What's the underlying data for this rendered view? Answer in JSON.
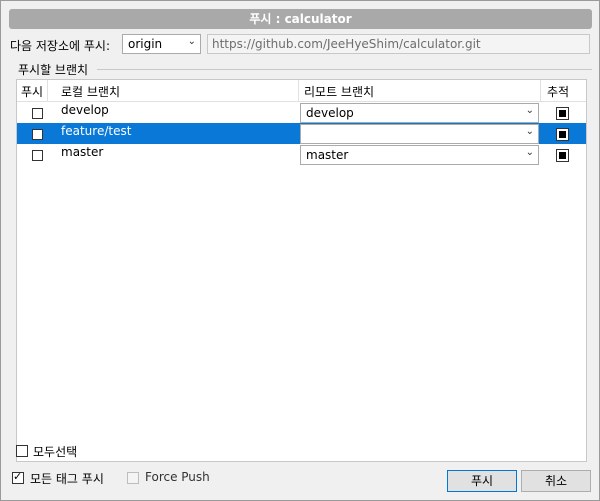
{
  "window": {
    "title": "푸시 : calculator"
  },
  "remote": {
    "label": "다음 저장소에 푸시:",
    "selected": "origin",
    "url": "https://github.com/JeeHyeShim/calculator.git"
  },
  "branches_group": {
    "label": "푸시할 브랜치",
    "columns": {
      "push": "푸시",
      "local": "로컬 브랜치",
      "remote": "리모트 브랜치",
      "track": "추적"
    },
    "rows": [
      {
        "local": "develop",
        "remote": "develop",
        "selected": false
      },
      {
        "local": "feature/test",
        "remote": "",
        "selected": true
      },
      {
        "local": "master",
        "remote": "master",
        "selected": false
      }
    ]
  },
  "select_all": {
    "label": "모두선택"
  },
  "options": {
    "push_all_tags": "모든 태그 푸시",
    "force_push": "Force Push"
  },
  "buttons": {
    "push": "푸시",
    "cancel": "취소"
  },
  "icons": {
    "dropdown": "chevron-down-icon",
    "check": "checkmark-icon"
  }
}
